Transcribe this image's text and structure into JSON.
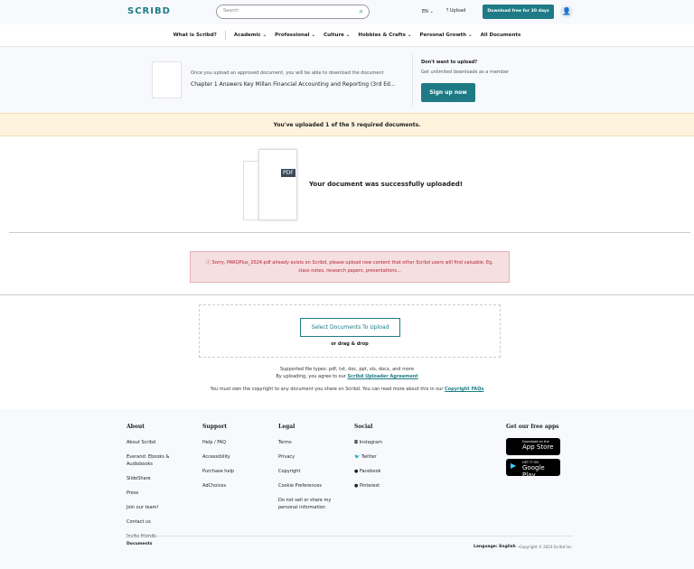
{
  "header": {
    "logo": "SCRIBD",
    "search_placeholder": "Search",
    "language": "EN",
    "upload": "Upload",
    "cta": "Download free for 30 days"
  },
  "nav": [
    {
      "label": "What is Scribd?"
    },
    {
      "label": "Academic ⌄"
    },
    {
      "label": "Professional ⌄"
    },
    {
      "label": "Culture ⌄"
    },
    {
      "label": "Hobbies & Crafts ⌄"
    },
    {
      "label": "Personal Growth ⌄"
    },
    {
      "label": "All Documents"
    }
  ],
  "download": {
    "info": "Once you upload an approved document, you will be able to download the document",
    "title": "Chapter 1 Answers Key Millan Financial Accounting and Reporting (3rd Ed...",
    "side_title": "Don't want to upload?",
    "side_text": "Get unlimited downloads as a member",
    "signup": "Sign up now"
  },
  "banner": "You've uploaded 1 of the 5 required documents.",
  "success": {
    "badge": "PDF",
    "text": "Your document was successfully uploaded!"
  },
  "error": "Sorry, PARQPlus_2024.pdf already exists on Scribd, please upload new content that other Scribd users will find valuable. Eg. class notes, research papers, presentations...",
  "upload": {
    "button": "Select Documents To Upload",
    "drag": "or drag & drop",
    "types": "Supported file types: pdf, txt, doc, ppt, xls, docx, and more",
    "agree_prefix": "By uploading, you agree to our ",
    "agree_link": "Scribd Uploader Agreement",
    "copyright_prefix": "You must own the copyright to any document you share on Scribd. You can read more about this in our ",
    "copyright_link": "Copyright FAQs"
  },
  "footer": {
    "about": {
      "title": "About",
      "items": [
        "About Scribd",
        "Everand: Ebooks & Audiobooks",
        "SlideShare",
        "Press",
        "Join our team!",
        "Contact us",
        "Invite friends"
      ]
    },
    "support": {
      "title": "Support",
      "items": [
        "Help / FAQ",
        "Accessibility",
        "Purchase help",
        "AdChoices"
      ]
    },
    "legal": {
      "title": "Legal",
      "items": [
        "Terms",
        "Privacy",
        "Copyright",
        "Cookie Preferences",
        "Do not sell or share my personal information"
      ]
    },
    "social": {
      "title": "Social",
      "items": [
        "Instagram",
        "Twitter",
        "Facebook",
        "Pinterest"
      ]
    },
    "apps": {
      "title": "Get our free apps",
      "appstore_small": "Download on the",
      "appstore": "App Store",
      "play_small": "GET IT ON",
      "play": "Google Play"
    },
    "documents": "Documents",
    "language": "Language: English",
    "copyright": "Copyright © 2024 Scribd Inc."
  }
}
